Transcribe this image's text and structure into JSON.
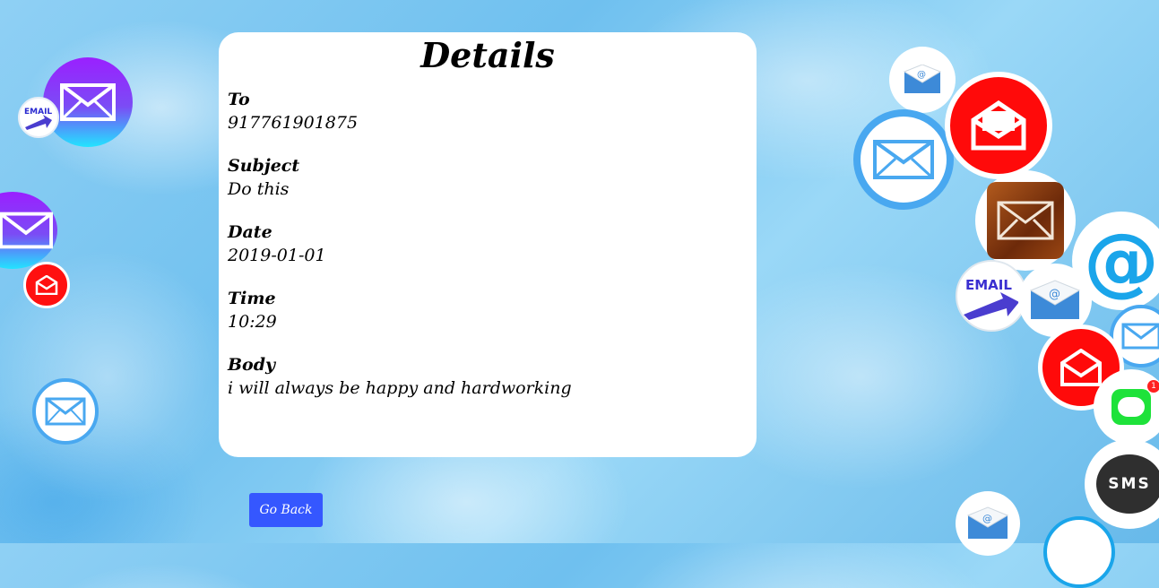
{
  "card": {
    "title": "Details",
    "fields": [
      {
        "label": "To",
        "value": "917761901875"
      },
      {
        "label": "Subject",
        "value": "Do this"
      },
      {
        "label": "Date",
        "value": "2019-01-01"
      },
      {
        "label": "Time",
        "value": "10:29"
      },
      {
        "label": "Body",
        "value": "i will always be happy and hardworking"
      }
    ]
  },
  "actions": {
    "go_back": "Go Back"
  },
  "decor": {
    "email_badge": "EMAIL",
    "at_symbol": "@",
    "sms_badge": "SMS",
    "notification_count": "1"
  },
  "colors": {
    "accent_button": "#3557ff",
    "red_icon": "#ff1010",
    "purple_icon": "#8e2cf5",
    "blue_ring": "#3aa0f0"
  }
}
